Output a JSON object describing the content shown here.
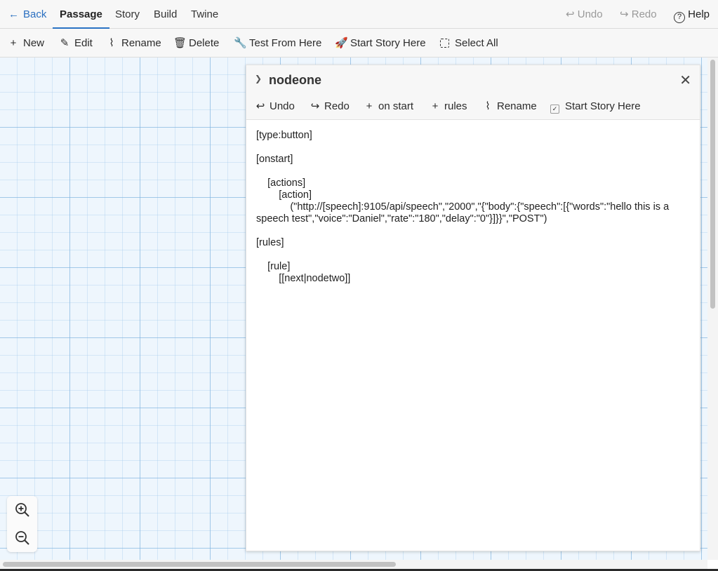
{
  "topbar": {
    "back_label": "Back",
    "tabs": [
      {
        "label": "Passage"
      },
      {
        "label": "Story"
      },
      {
        "label": "Build"
      },
      {
        "label": "Twine"
      }
    ],
    "undo_label": "Undo",
    "redo_label": "Redo",
    "help_label": "Help"
  },
  "toolbar": {
    "new_label": "New",
    "edit_label": "Edit",
    "rename_label": "Rename",
    "delete_label": "Delete",
    "test_label": "Test From Here",
    "start_label": "Start Story Here",
    "select_all_label": "Select All"
  },
  "dialog": {
    "title": "nodeone",
    "undo_label": "Undo",
    "redo_label": "Redo",
    "on_start_label": "on start",
    "rules_label": "rules",
    "rename_label": "Rename",
    "start_label": "Start Story Here",
    "text_lines": [
      "[type:button]",
      "",
      "[onstart]",
      "",
      "    [actions]",
      "        [action]",
      "            (\"http://[speech]:9105/api/speech\",\"2000\",\"{\"body\":{\"speech\":[{\"words\":\"hello this is a speech test\",\"voice\":\"Daniel\",\"rate\":\"180\",\"delay\":\"0\"}]}}\",\"POST\")",
      "",
      "[rules]",
      "",
      "    [rule]",
      "        [[next|nodetwo]]"
    ]
  },
  "icons": {
    "zoom_in": "zoom-in-icon",
    "zoom_out": "zoom-out-icon"
  },
  "colors": {
    "accent": "#2a73c4",
    "canvas": "#eef6fd",
    "disabled": "#9a9a9a"
  }
}
